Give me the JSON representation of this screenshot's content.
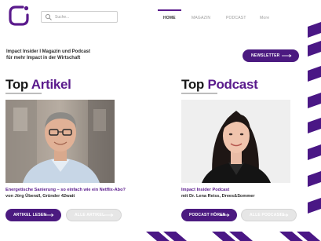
{
  "header": {
    "search_placeholder": "Suche...",
    "nav": [
      {
        "label": "HOME"
      },
      {
        "label": "MAGAZIN"
      },
      {
        "label": "PODCAST"
      },
      {
        "label": "More"
      }
    ]
  },
  "intro": {
    "line1": "Impact Insider I Magazin und Podcast",
    "line2": "für mehr Impact in der Wirtschaft",
    "newsletter_button": "NEWSLETTER"
  },
  "articles": {
    "heading_top": "Top",
    "heading_accent": "Artikel",
    "title": "Energetische Sanierung – so einfach wie ein Netflix-Abo?",
    "byline": "von Jörg Überall, Gründer 42watt",
    "primary_button": "ARTIKEL LESEN",
    "secondary_button": "ALLE ARTIKEL"
  },
  "podcast": {
    "heading_top": "Top",
    "heading_accent": "Podcast",
    "title": "Impact Insider Podcast",
    "byline": "mit Dr. Lena Reiss, Drees&Sommer",
    "primary_button": "PODCAST HÖREN",
    "secondary_button": "ALLE PODCASTS"
  },
  "colors": {
    "brand_purple": "#4b1a80",
    "accent_purple": "#5a1a8c",
    "stripe_purple": "#4a1785"
  },
  "icons": [
    "logo-icon",
    "search-icon",
    "arrow-right-icon"
  ]
}
